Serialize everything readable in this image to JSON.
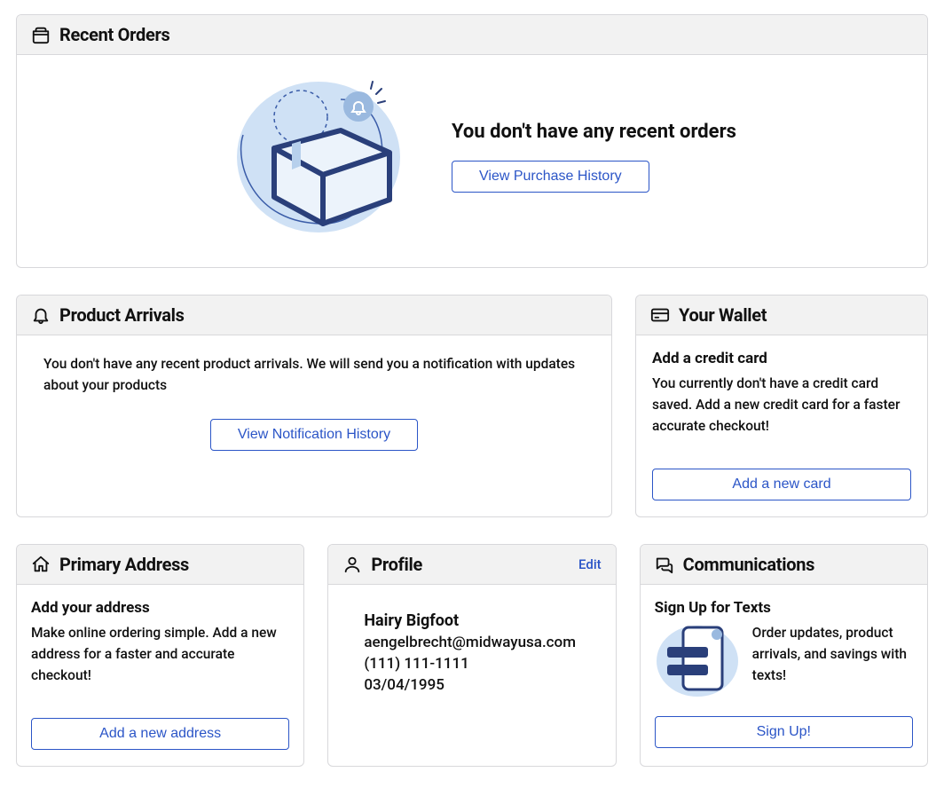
{
  "recent_orders": {
    "title": "Recent Orders",
    "empty_headline": "You don't have any recent orders",
    "history_button": "View Purchase History"
  },
  "product_arrivals": {
    "title": "Product Arrivals",
    "empty_text": "You don't have any recent product arrivals. We will send you a notification with updates about your products",
    "history_button": "View Notification History"
  },
  "wallet": {
    "title": "Your Wallet",
    "subtitle": "Add a credit card",
    "body": "You currently don't have a credit card saved. Add a new credit card for a faster accurate checkout!",
    "button": "Add a new card"
  },
  "address": {
    "title": "Primary Address",
    "subtitle": "Add your address",
    "body": "Make online ordering simple. Add a new address for a faster and accurate checkout!",
    "button": "Add a new address"
  },
  "profile": {
    "title": "Profile",
    "edit": "Edit",
    "name": "Hairy Bigfoot",
    "email": "aengelbrecht@midwayusa.com",
    "phone": "(111) 111-1111",
    "dob": "03/04/1995"
  },
  "communications": {
    "title": "Communications",
    "subtitle": "Sign Up for Texts",
    "body": "Order updates, product arrivals, and savings with texts!",
    "button": "Sign Up!"
  }
}
